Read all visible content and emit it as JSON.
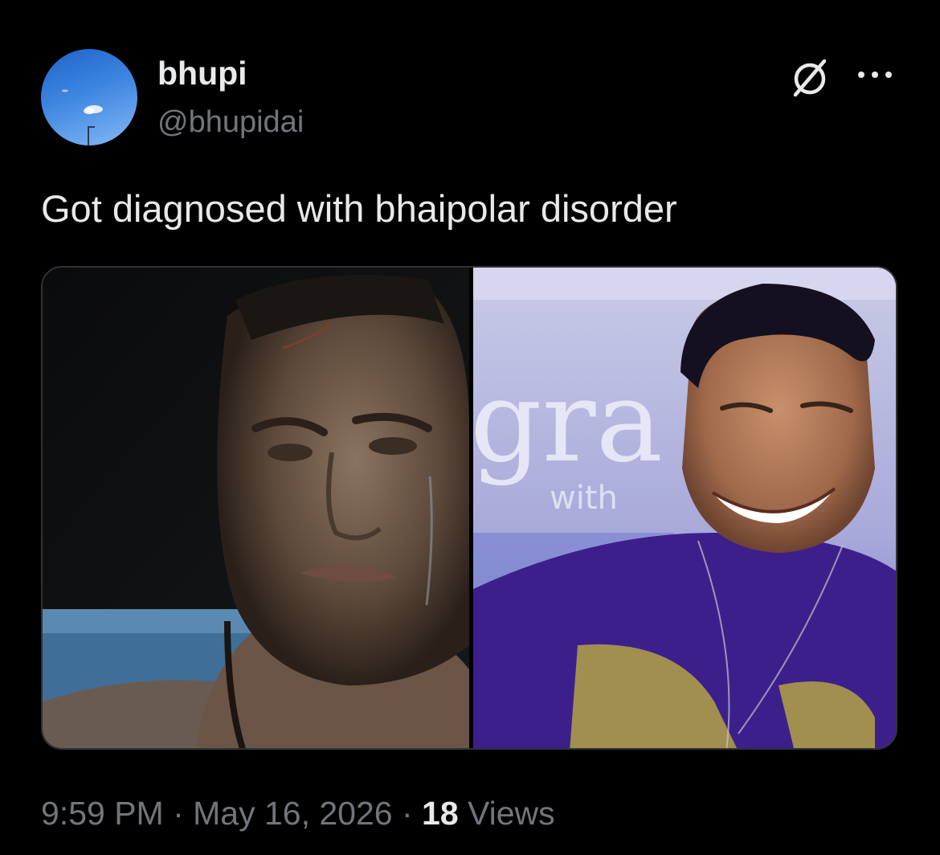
{
  "author": {
    "display_name": "bhupi",
    "handle": "@bhupidai"
  },
  "tweet": {
    "text": "Got diagnosed with bhaipolar disorder"
  },
  "media": {
    "images": [
      {
        "description": "man crying"
      },
      {
        "description": "man laughing"
      }
    ],
    "overlay_text": [
      "gra",
      "with"
    ]
  },
  "meta": {
    "time": "9:59 PM",
    "separator": " · ",
    "date": "May 16, 2026",
    "views_count": "18",
    "views_label": " Views"
  },
  "icons": {
    "grok": "grok-icon",
    "more": "more-options-icon"
  },
  "colors": {
    "background": "#000000",
    "text_primary": "#e7e9ea",
    "text_secondary": "#71767b",
    "border": "#2f3336"
  }
}
